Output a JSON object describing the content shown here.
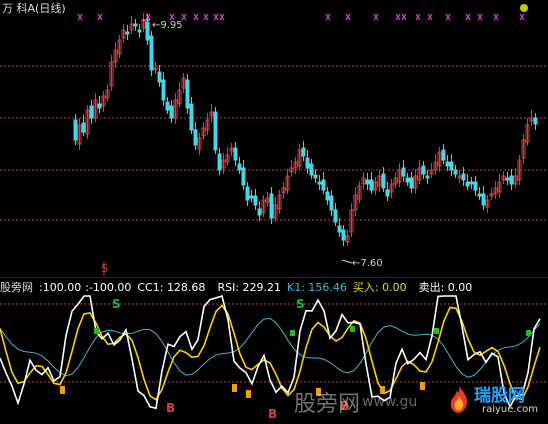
{
  "header": {
    "title": "万 科A(日线)"
  },
  "annotations": {
    "high": "9.95",
    "low": "7.60",
    "arrow_prefix": "←",
    "s_top": "S"
  },
  "indicator": {
    "name": "股旁网",
    "v1": ":100.00",
    "v2": ":-100.00",
    "cc1": "CC1: 128.68",
    "rsi": "RSI: 229.21",
    "k1": "K1: 156.46",
    "buy": "买入: 0.00",
    "sell": "卖出: 0.00",
    "marker_s": "S",
    "marker_b": "B"
  },
  "watermark": {
    "cn": "股旁网",
    "url": "www.gu",
    "logo_cn": "瑞股网",
    "logo_en": "raiyue.com"
  },
  "colors": {
    "up": "#e03a3a",
    "down": "#40d8e8",
    "grid": "#b04040",
    "buy": "#22bb22",
    "sell": "#dddd22",
    "white_line": "#ffffff",
    "yellow_line": "#ffd000",
    "cyan_line": "#3fb8d8",
    "magenta": "#d040d0"
  },
  "chart_data": {
    "type": "candlestick",
    "title": "万 科A(日线)",
    "high_label": 9.95,
    "low_label": 7.6,
    "note": "daily candles, price range approx 7.60 to 9.95"
  }
}
